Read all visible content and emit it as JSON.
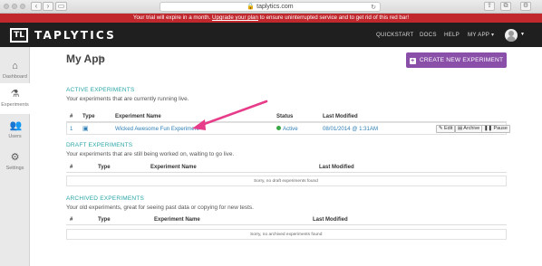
{
  "browser": {
    "url": "taplytics.com"
  },
  "trial_banner": {
    "text_before": "Your trial will expire in a month.",
    "link": "Upgrade your plan",
    "text_after": "to ensure uninterrupted service and to get rid of this red bar!"
  },
  "topnav": {
    "logo_mark": "TL",
    "logo_text": "TAPLYTICS",
    "links": [
      "QUICKSTART",
      "DOCS",
      "HELP",
      "MY APP"
    ]
  },
  "sidebar": {
    "items": [
      {
        "label": "Dashboard",
        "icon": "home-icon"
      },
      {
        "label": "Experiments",
        "icon": "flask-icon"
      },
      {
        "label": "Users",
        "icon": "users-icon"
      },
      {
        "label": "Settings",
        "icon": "gear-icon"
      }
    ]
  },
  "page": {
    "title": "My App",
    "create_button": "CREATE NEW EXPERIMENT"
  },
  "active": {
    "title": "ACTIVE EXPERIMENTS",
    "desc": "Your experiments that are currently running live.",
    "headers": [
      "#",
      "Type",
      "Experiment Name",
      "Status",
      "Last Modified"
    ],
    "row": {
      "num": "1",
      "name": "Wicked Awesome Fun Experiment",
      "status": "Active",
      "modified": "08/01/2014 @ 1:31AM",
      "actions": [
        "Edit",
        "Archive",
        "Pause"
      ]
    }
  },
  "draft": {
    "title": "DRAFT EXPERIMENTS",
    "desc": "Your experiments that are still being worked on, waiting to go live.",
    "headers": [
      "#",
      "Type",
      "Experiment Name",
      "Last Modified"
    ],
    "empty": "Sorry, no draft experiments found"
  },
  "archived": {
    "title": "ARCHIVED EXPERIMENTS",
    "desc": "Your old experiments, great for seeing past data or copying for new tests.",
    "headers": [
      "#",
      "Type",
      "Experiment Name",
      "Last Modified"
    ],
    "empty": "Sorry, no archived experiments found"
  },
  "colors": {
    "banner": "#c0282e",
    "nav": "#1f1f1f",
    "accent": "#2aa6a8",
    "button": "#8a4fa8",
    "arrow": "#e63c8a"
  }
}
